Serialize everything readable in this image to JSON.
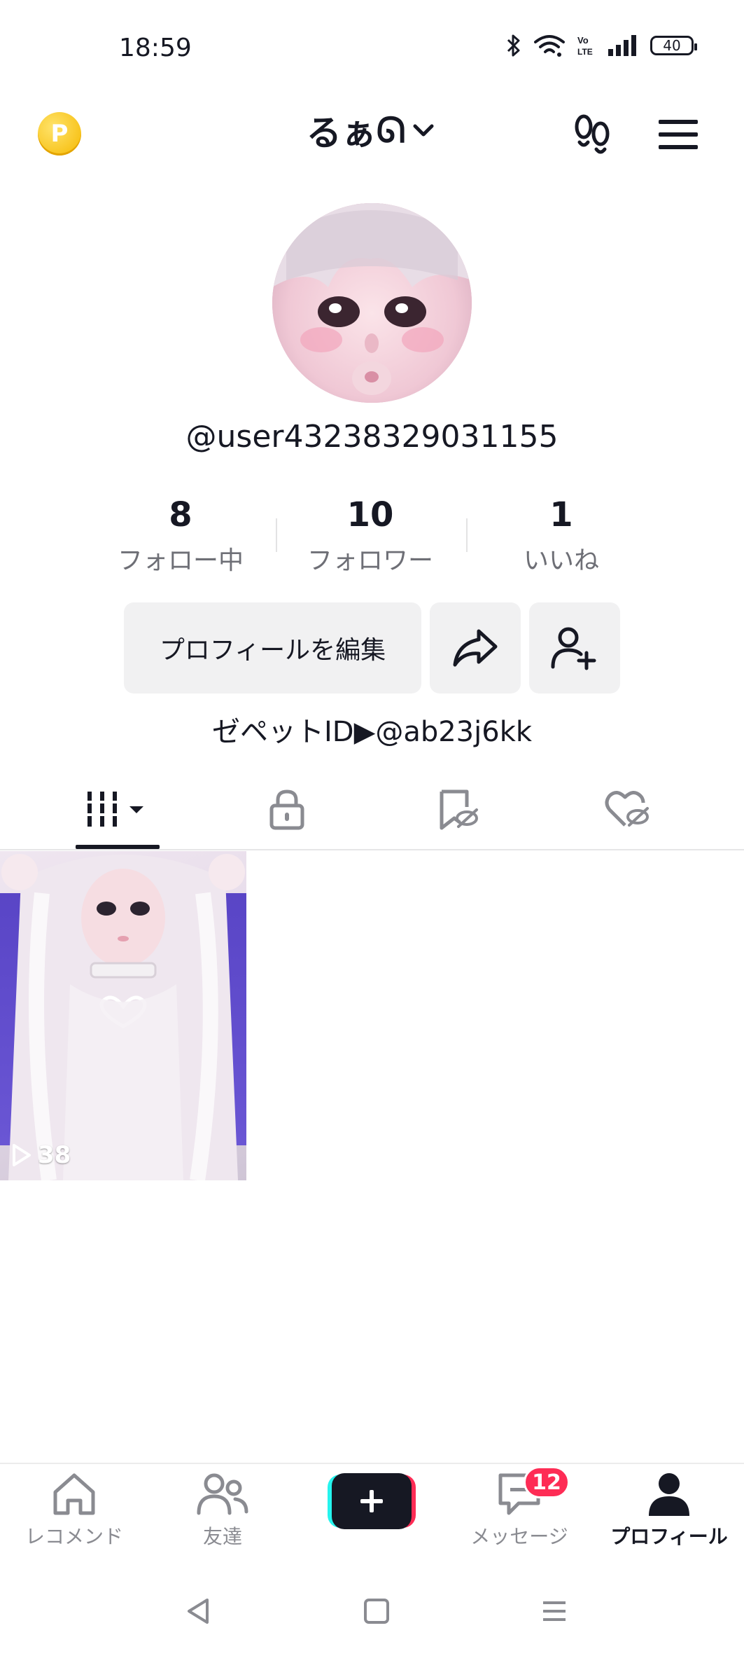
{
  "status_bar": {
    "time": "18:59",
    "battery": "40",
    "icons": [
      "bluetooth-icon",
      "wifi-icon",
      "volte-icon",
      "signal-icon",
      "battery-icon"
    ]
  },
  "header": {
    "coin_label": "P",
    "title": "るぁ",
    "title_glyph": "ᘏ",
    "footprints_icon": "footprints-icon",
    "menu_icon": "hamburger-menu-icon"
  },
  "profile": {
    "handle": "@user43238329031155",
    "stats": [
      {
        "value": "8",
        "label": "フォロー中"
      },
      {
        "value": "10",
        "label": "フォロワー"
      },
      {
        "value": "1",
        "label": "いいね"
      }
    ],
    "edit_button_label": "プロフィールを編集",
    "bio": "ゼペットID▶@ab23j6kk"
  },
  "tabs": [
    {
      "name": "videos",
      "icon": "grid-icon",
      "active": true
    },
    {
      "name": "private",
      "icon": "lock-icon",
      "active": false
    },
    {
      "name": "favorites",
      "icon": "bookmark-hidden-icon",
      "active": false
    },
    {
      "name": "liked",
      "icon": "heart-hidden-icon",
      "active": false
    }
  ],
  "videos": [
    {
      "views": "38"
    }
  ],
  "bottom_nav": {
    "items": [
      {
        "label": "レコメンド",
        "icon": "home-icon"
      },
      {
        "label": "友達",
        "icon": "friends-icon"
      },
      {
        "label": "",
        "icon": "create-plus-icon"
      },
      {
        "label": "メッセージ",
        "icon": "inbox-icon"
      },
      {
        "label": "プロフィール",
        "icon": "profile-icon"
      }
    ],
    "message_badge": "12"
  },
  "colors": {
    "accent": "#fe2c55",
    "cyan": "#25f4ee",
    "text": "#161823",
    "muted": "#6e6f76"
  }
}
